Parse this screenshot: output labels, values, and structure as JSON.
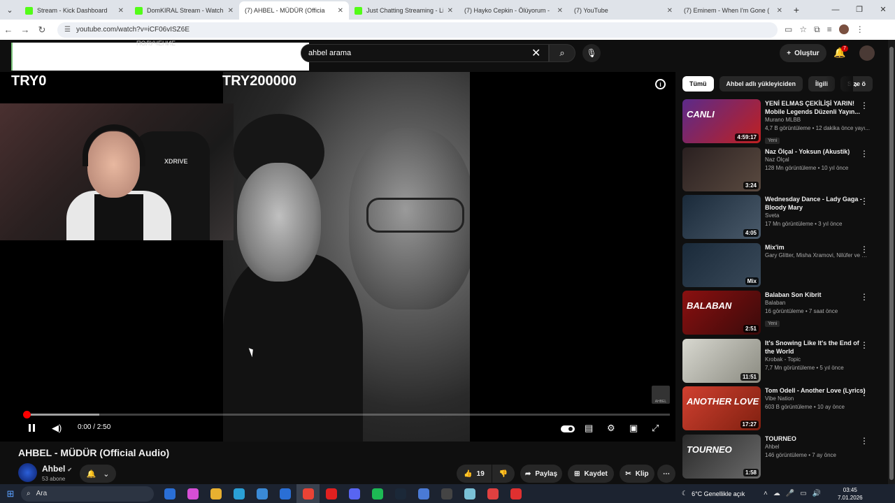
{
  "browser": {
    "tabs": [
      {
        "title": "Stream - Kick Dashboard",
        "favicon": "kick-icon"
      },
      {
        "title": "DomKIRAL Stream - Watch Live",
        "favicon": "kick-icon"
      },
      {
        "title": "(7) AHBEL - MÜDÜR (Officia",
        "favicon": "youtube-icon",
        "active": true
      },
      {
        "title": "Just Chatting Streaming - Live",
        "favicon": "kick-icon"
      },
      {
        "title": "(7) Hayko Cepkin - Ölüyorum -",
        "favicon": "youtube-icon"
      },
      {
        "title": "(7) YouTube",
        "favicon": "youtube-icon"
      },
      {
        "title": "(7) Eminem - When I'm Gone (",
        "favicon": "youtube-icon"
      }
    ],
    "url": "youtube.com/watch?v=iCF06vISZ6E"
  },
  "header": {
    "search_value": "ahbel arama",
    "create_label": "Oluştur",
    "notification_count": "7",
    "ghost_text": "ПОЛУЧЕНИЕ"
  },
  "player": {
    "overlay_left": "TRY0",
    "overlay_right": "TRY200000",
    "time": "0:00 / 2:50",
    "played_fraction": 0.003,
    "buffered_fraction": 0.113,
    "cam_brand": "XDRIVE",
    "watermark": "AHBEL"
  },
  "video": {
    "title": "AHBEL - MÜDÜR (Official Audio)",
    "channel": "Ahbel",
    "subscribers": "53 abone",
    "likes": "19",
    "share_label": "Paylaş",
    "save_label": "Kaydet",
    "clip_label": "Klip"
  },
  "chips": [
    "Tümü",
    "Ahbel adlı yükleyiciden",
    "İlgili",
    "Size ö"
  ],
  "recommendations": [
    {
      "title": "YENİ ELMAS ÇEKİLİŞİ YARIN! Mobile Legends Düzenli Yayın...",
      "channel": "Murano MLBB",
      "verified": true,
      "stats": "4,7 B görüntüleme • 12 dakika önce yayı...",
      "badge": "Yeni",
      "duration": "4:59:17",
      "thumb_text": "CANLI",
      "color_a": "#5b2a8a",
      "color_b": "#c02020"
    },
    {
      "title": "Naz Ölçal - Yoksun (Akustik)",
      "channel": "Naz Ölçal",
      "verified": true,
      "stats": "128 Mn görüntüleme • 10 yıl önce",
      "badge": "",
      "duration": "3:24",
      "thumb_text": "",
      "color_a": "#2a2020",
      "color_b": "#5a4a40"
    },
    {
      "title": "Wednesday Dance - Lady Gaga - Bloody Mary",
      "channel": "Sveta",
      "verified": false,
      "stats": "17 Mn görüntüleme • 3 yıl önce",
      "badge": "",
      "duration": "4:05",
      "thumb_text": "",
      "color_a": "#1a2a3a",
      "color_b": "#4a5a6a"
    },
    {
      "title": "Mix'im",
      "channel": "Gary Glitter, Misha Xramovi, Nilüfer ve da...",
      "verified": false,
      "stats": "",
      "badge": "",
      "duration": "Mix",
      "thumb_text": "",
      "color_a": "#1a2a3a",
      "color_b": "#3a4a5a"
    },
    {
      "title": "Balaban Son Kibrit",
      "channel": "Balaban",
      "verified": false,
      "stats": "16 görüntüleme • 7 saat önce",
      "badge": "Yeni",
      "duration": "2:51",
      "thumb_text": "BALABAN",
      "color_a": "#8a1010",
      "color_b": "#3a0a0a"
    },
    {
      "title": "It's Snowing Like It's the End of the World",
      "channel": "Krobak - Topic",
      "verified": false,
      "stats": "7,7 Mn görüntüleme • 5 yıl önce",
      "badge": "",
      "duration": "11:51",
      "thumb_text": "",
      "color_a": "#d8d8d0",
      "color_b": "#8a8a80"
    },
    {
      "title": "Tom Odell - Another Love (Lyrics)",
      "channel": "Vibe Nation",
      "verified": false,
      "stats": "603 B görüntüleme • 10 ay önce",
      "badge": "",
      "duration": "17:27",
      "thumb_text": "ANOTHER LOVE",
      "color_a": "#d04030",
      "color_b": "#802010"
    },
    {
      "title": "TOURNEO",
      "channel": "Ahbel",
      "verified": true,
      "stats": "146 görüntüleme • 7 ay önce",
      "badge": "",
      "duration": "1:58",
      "thumb_text": "TOURNEO",
      "color_a": "#2a2a2a",
      "color_b": "#6a6a6a"
    }
  ],
  "taskbar": {
    "search_label": "Ara",
    "weather": "6°C  Genellikle açık",
    "time": "03:45",
    "date": "7.01.2026"
  }
}
